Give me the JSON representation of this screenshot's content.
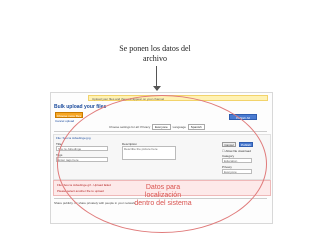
{
  "caption": {
    "line1": "Se ponen los datos del",
    "line2": "archivo"
  },
  "notice": "Upload your files and they will appear on your channel",
  "header": {
    "title": "Bulk upload your files",
    "choose_button": "Choose more files",
    "cancel_link": "Cancel upload",
    "publish_all": "Publish All"
  },
  "controls": {
    "prefix": "Choose settings for all:",
    "privacy_label": "Privacy",
    "privacy_value": "Everyone",
    "language_label": "Language",
    "language_value": "Spanish"
  },
  "file1": {
    "name": "File: Sou la Jobedinge.jpg",
    "title_label": "Title",
    "title_value": "Sou la Jobedinge",
    "description_label": "Description",
    "description_value": "Describe the picture here",
    "tags_label": "Tags",
    "tags_value": "Enter tags here",
    "cancel": "Cancel",
    "publish": "Publish",
    "download_label": "Allow file download",
    "category_label": "Category",
    "category_value": "Education",
    "privacy_label": "Privacy",
    "privacy_value": "Everyone"
  },
  "error": {
    "line1": "File: Sou la Jobedinge.gif - Upload failed",
    "line2": "Please select another file to upload"
  },
  "footer": "Share publicly. Or share privately with people in your network.",
  "overlay": {
    "line1": "Datos para localización",
    "line2": "dentro del sistema"
  },
  "colors": {
    "accent_blue": "#1a4a9c",
    "button_orange": "#f6a623",
    "overlay_red": "#d9534f"
  }
}
